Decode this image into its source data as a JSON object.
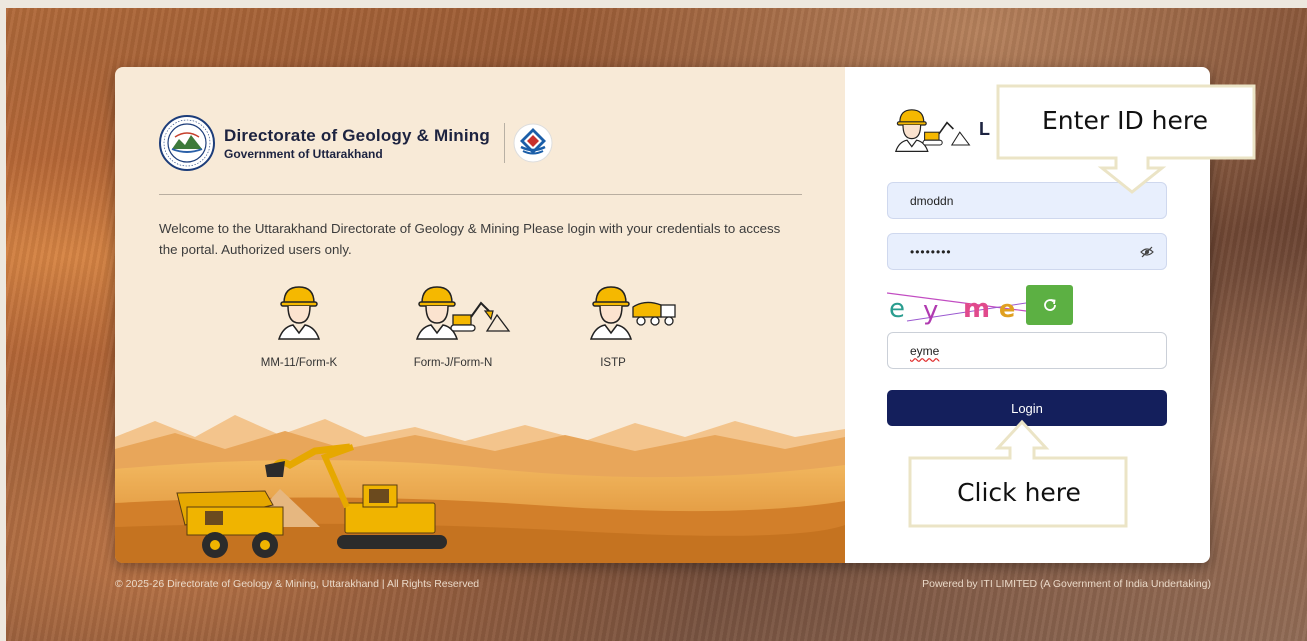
{
  "header": {
    "org_title": "Directorate of Geology & Mining",
    "org_subtitle": "Government of Uttarakhand",
    "seal_text": "भूतत्व एवं खनिकर्म इकाई"
  },
  "welcome_text": "Welcome to the Uttarakhand Directorate of Geology & Mining Please login with your credentials to access the portal. Authorized users only.",
  "roles": [
    {
      "label": "MM-11/Form-K",
      "icon": "worker-icon"
    },
    {
      "label": "Form-J/Form-N",
      "icon": "worker-excavator-icon"
    },
    {
      "label": "ISTP",
      "icon": "worker-truck-icon"
    }
  ],
  "login": {
    "title": "L",
    "username_value": "dmoddn",
    "password_value": "••••••••",
    "captcha_text": "eyme",
    "captcha_input_value": "eyme",
    "button_label": "Login"
  },
  "annotations": {
    "enter_id": "Enter ID here",
    "click_here": "Click here"
  },
  "footer": {
    "copyright": "© 2025-26 Directorate of Geology & Mining, Uttarakhand | All Rights Reserved",
    "powered_by": "Powered by ITI LIMITED (A Government of India Undertaking)"
  },
  "colors": {
    "primary": "#141f5c",
    "refresh": "#5cb043",
    "panel": "#f8ead7",
    "input_bg": "#e8effd"
  }
}
